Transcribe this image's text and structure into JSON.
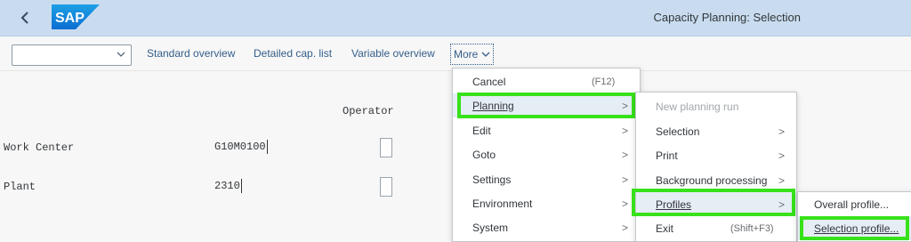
{
  "header": {
    "title": "Capacity Planning: Selection",
    "logo_text": "SAP",
    "back_icon": "chevron-left-icon"
  },
  "toolbar": {
    "combo_value": "",
    "standard_overview": "Standard overview",
    "detailed_cap_list": "Detailed cap. list",
    "variable_overview": "Variable overview",
    "more": "More"
  },
  "form": {
    "column_header": "Operator",
    "fields": [
      {
        "label": "Work Center",
        "value": "G10M0100"
      },
      {
        "label": "Plant",
        "value": "2310"
      }
    ]
  },
  "menu_main": {
    "items": [
      {
        "label": "Cancel",
        "shortcut": "(F12)"
      },
      {
        "label": "Planning"
      },
      {
        "label": "Edit"
      },
      {
        "label": "Goto"
      },
      {
        "label": "Settings"
      },
      {
        "label": "Environment"
      },
      {
        "label": "System"
      }
    ]
  },
  "menu_planning": {
    "items": [
      {
        "label": "New planning run"
      },
      {
        "label": "Selection"
      },
      {
        "label": "Print"
      },
      {
        "label": "Background processing"
      },
      {
        "label": "Profiles"
      },
      {
        "label": "Exit",
        "shortcut": "(Shift+F3)"
      }
    ]
  },
  "menu_profiles": {
    "items": [
      {
        "label": "Overall profile..."
      },
      {
        "label": "Selection profile..."
      }
    ]
  },
  "colors": {
    "shell_bg": "#c9dcef",
    "highlight": "#37e21a",
    "link": "#345e8a"
  }
}
